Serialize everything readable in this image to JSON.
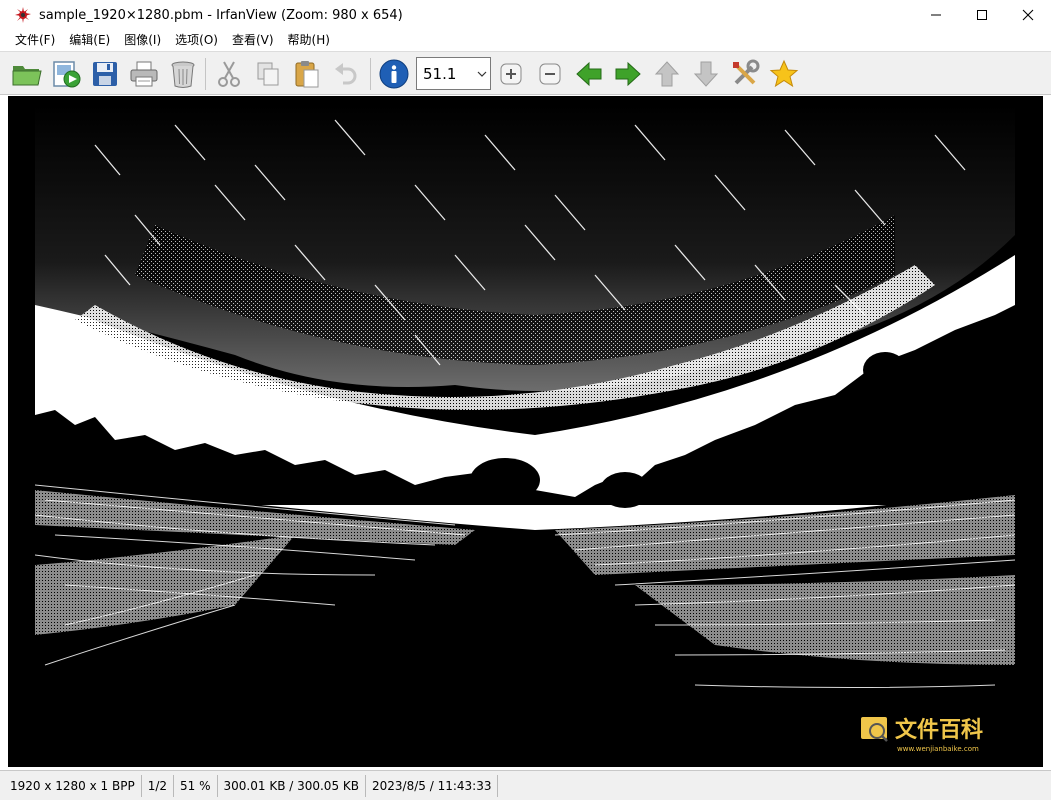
{
  "window": {
    "title": "sample_1920×1280.pbm - IrfanView (Zoom: 980 x 654)",
    "minimize_icon": "minimize-icon",
    "maximize_icon": "maximize-icon",
    "close_icon": "close-icon"
  },
  "menu": {
    "items": [
      "文件(F)",
      "编辑(E)",
      "图像(I)",
      "选项(O)",
      "查看(V)",
      "帮助(H)"
    ]
  },
  "toolbar": {
    "zoom_value": "51.1",
    "buttons": [
      "open-folder-icon",
      "slideshow-icon",
      "save-icon",
      "print-icon",
      "delete-icon",
      "cut-icon",
      "copy-icon",
      "paste-icon",
      "undo-icon",
      "info-icon",
      "zoom-in-icon",
      "zoom-out-icon",
      "previous-icon",
      "next-icon",
      "up-icon",
      "down-icon",
      "settings-icon",
      "favorite-icon"
    ],
    "colors": {
      "green_arrow": "#3fa22a",
      "info_blue": "#1f5fb5",
      "star_gold": "#f7c31a"
    }
  },
  "watermark": {
    "brand": "文件百科",
    "url": "www.wenjianbaike.com"
  },
  "status": {
    "dimensions": "1920 x 1280 x 1 BPP",
    "page": "1/2",
    "zoom": "51 %",
    "size": "300.01 KB / 300.05 KB",
    "datetime": "2023/8/5 / 11:43:33"
  }
}
